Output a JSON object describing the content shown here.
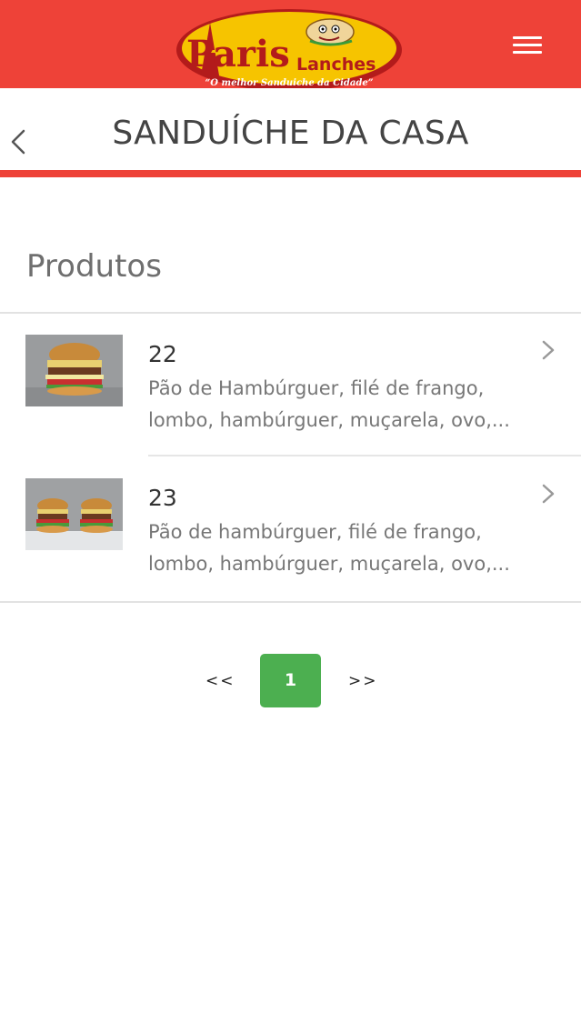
{
  "header": {
    "logo": {
      "brand_main": "Paris",
      "brand_sub": "Lanches",
      "slogan": "“O melhor Sanduiche da Cidade”"
    },
    "menu_icon": "hamburger-menu-icon",
    "brand_color": "#ee4238"
  },
  "title_bar": {
    "back_icon": "chevron-left-icon",
    "title": "SANDUÍCHE DA CASA"
  },
  "section": {
    "title": "Produtos"
  },
  "products": [
    {
      "title": "22",
      "description": "Pão de Hambúrguer, filé de frango,",
      "description_line2": "lombo, hambúrguer, muçarela, ovo,...",
      "thumbnail": "burger-photo"
    },
    {
      "title": "23",
      "description": "Pão de hambúrguer, filé de frango,",
      "description_line2": "lombo, hambúrguer, muçarela, ovo,...",
      "thumbnail": "two-burgers-photo"
    }
  ],
  "pagination": {
    "prev": "<<",
    "current": "1",
    "next": ">>",
    "active_color": "#4caf50"
  }
}
